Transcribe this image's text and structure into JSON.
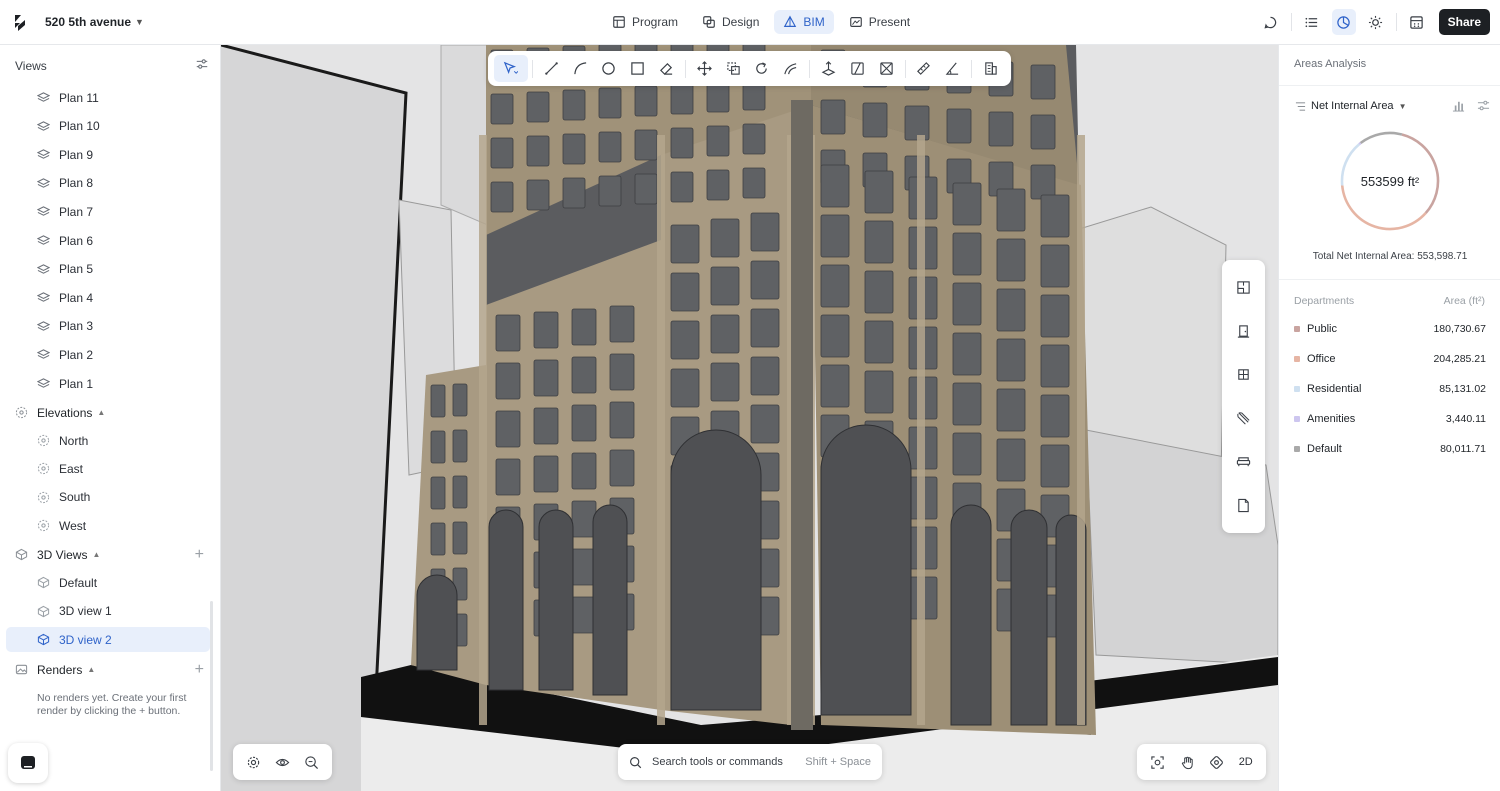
{
  "header": {
    "project_name": "520 5th avenue",
    "modes": [
      {
        "label": "Program",
        "icon": "table-icon"
      },
      {
        "label": "Design",
        "icon": "design-icon"
      },
      {
        "label": "BIM",
        "icon": "bim-icon",
        "active": true
      },
      {
        "label": "Present",
        "icon": "present-icon"
      }
    ],
    "share_label": "Share"
  },
  "sidebar": {
    "title": "Views",
    "plans": [
      "Plan 11",
      "Plan 10",
      "Plan 9",
      "Plan 8",
      "Plan 7",
      "Plan 6",
      "Plan 5",
      "Plan 4",
      "Plan 3",
      "Plan 2",
      "Plan 1"
    ],
    "elevations_label": "Elevations",
    "elevations": [
      "North",
      "East",
      "South",
      "West"
    ],
    "views3d_label": "3D Views",
    "views3d": [
      "Default",
      "3D view 1",
      "3D view 2"
    ],
    "selected_view": "3D view 2",
    "renders_label": "Renders",
    "renders_empty": "No renders yet. Create your first render by clicking the + button."
  },
  "viewport": {
    "search_placeholder": "Search tools or commands",
    "search_shortcut": "Shift + Space",
    "view_mode_label": "2D"
  },
  "right_panel": {
    "title": "Areas Analysis",
    "metric": "Net Internal Area",
    "total_value": "553599 ft²",
    "total_label": "Total Net Internal Area: 553,598.71",
    "dept_header": "Departments",
    "area_header": "Area (ft²)",
    "departments": [
      {
        "name": "Public",
        "value": "180,730.67",
        "color": "#c9a4a0"
      },
      {
        "name": "Office",
        "value": "204,285.21",
        "color": "#e6b5a4"
      },
      {
        "name": "Residential",
        "value": "85,131.02",
        "color": "#cfe0f0"
      },
      {
        "name": "Amenities",
        "value": "3,440.11",
        "color": "#cdc6ef"
      },
      {
        "name": "Default",
        "value": "80,011.71",
        "color": "#a9a9a9"
      }
    ]
  },
  "colors": {
    "accent": "#2f63c9",
    "accent_bg": "#e8effb",
    "facade": "#a89a82",
    "glass": "#5f6164"
  }
}
